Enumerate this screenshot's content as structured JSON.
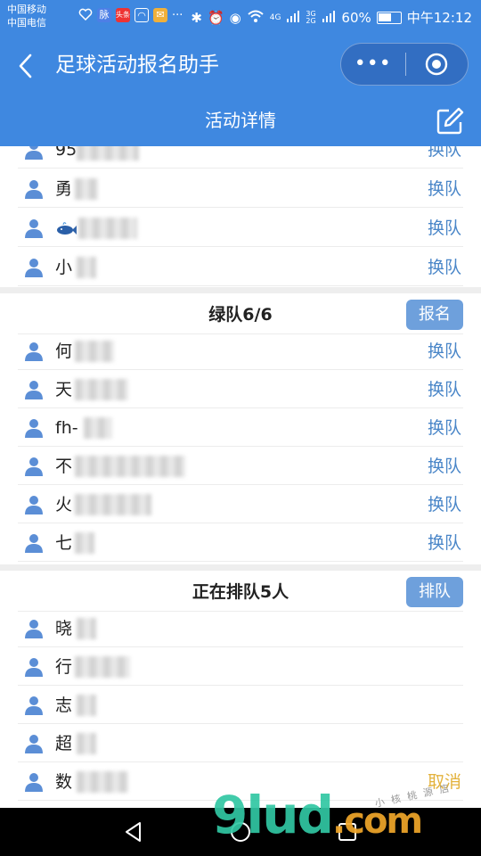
{
  "statusbar": {
    "carrier1": "中国移动",
    "carrier2": "中国电信",
    "badge_toutiao": "头条",
    "more_dots": "···",
    "network": "4G",
    "network2": "3G 2G",
    "battery_text": "60%",
    "battery_level": 0.6,
    "time": "中午12:12"
  },
  "header": {
    "app_title": "足球活动报名助手",
    "more_label": "•••",
    "page_title": "活动详情"
  },
  "sections": {
    "top_rows": [
      {
        "name": "95",
        "action": "换队"
      },
      {
        "name": "勇",
        "action": "换队"
      },
      {
        "name": "",
        "action": "换队"
      },
      {
        "name": "小",
        "action": "换队"
      }
    ],
    "green": {
      "title": "绿队6/6",
      "button": "报名",
      "rows": [
        {
          "name": "何",
          "action": "换队"
        },
        {
          "name": "天",
          "action": "换队"
        },
        {
          "name": "fh-",
          "action": "换队"
        },
        {
          "name": "不",
          "action": "换队"
        },
        {
          "name": "火",
          "action": "换队"
        },
        {
          "name": "七",
          "action": "换队"
        }
      ]
    },
    "queue": {
      "title": "正在排队5人",
      "button": "排队",
      "rows": [
        {
          "name": "晓",
          "action": ""
        },
        {
          "name": "行",
          "action": ""
        },
        {
          "name": "志",
          "action": ""
        },
        {
          "name": "超",
          "action": ""
        },
        {
          "name": "数",
          "action": "取消"
        }
      ]
    }
  },
  "watermark": {
    "main": "9lud",
    "suffix": ".com",
    "small": "小 核 桃 源 店"
  },
  "colors": {
    "header_blue": "#3f88e0",
    "action_blue": "#4a86c8",
    "button_blue": "#6ea0dc",
    "cancel_yellow": "#e3b23c",
    "avatar_blue": "#5b8ed6"
  }
}
